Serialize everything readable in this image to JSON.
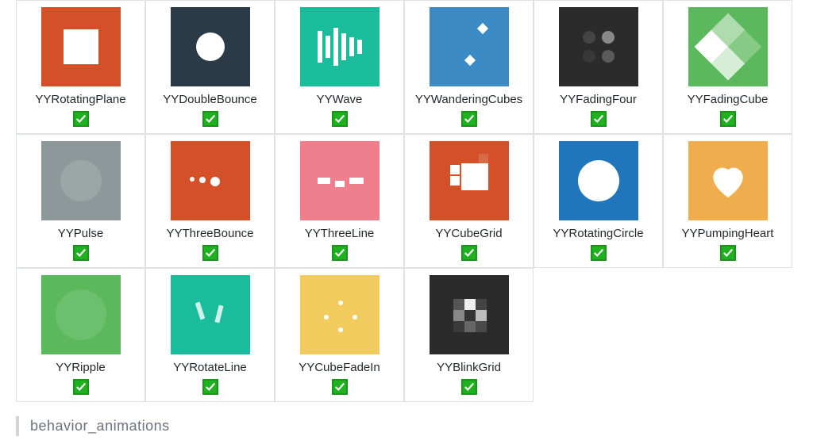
{
  "colors": {
    "orange": "#d35028",
    "darknavy": "#2a3a47",
    "teal": "#1abc9c",
    "blue": "#3b8ac4",
    "charcoal": "#2b2b2b",
    "green": "#5cb85c",
    "grey": "#8c9899",
    "pink": "#ef7f8d",
    "bluestrong": "#2075bb",
    "amber": "#f0ad4e",
    "mustard": "#f2cb5f",
    "check_green": "#1fb11f"
  },
  "animations": {
    "rows": [
      [
        {
          "id": "rotating-plane",
          "label": "YYRotatingPlane",
          "bg": "orange",
          "checked": true
        },
        {
          "id": "double-bounce",
          "label": "YYDoubleBounce",
          "bg": "darknavy",
          "checked": true
        },
        {
          "id": "wave",
          "label": "YYWave",
          "bg": "teal",
          "checked": true
        },
        {
          "id": "wandering-cubes",
          "label": "YYWanderingCubes",
          "bg": "blue",
          "checked": true
        },
        {
          "id": "fading-four",
          "label": "YYFadingFour",
          "bg": "charcoal",
          "checked": true
        },
        {
          "id": "fading-cube",
          "label": "YYFadingCube",
          "bg": "green",
          "checked": true
        }
      ],
      [
        {
          "id": "pulse",
          "label": "YYPulse",
          "bg": "grey",
          "checked": true
        },
        {
          "id": "three-bounce",
          "label": "YYThreeBounce",
          "bg": "orange",
          "checked": true
        },
        {
          "id": "three-line",
          "label": "YYThreeLine",
          "bg": "pink",
          "checked": true
        },
        {
          "id": "cube-grid",
          "label": "YYCubeGrid",
          "bg": "orange",
          "checked": true
        },
        {
          "id": "rotating-circle",
          "label": "YYRotatingCircle",
          "bg": "bluestrong",
          "checked": true
        },
        {
          "id": "pumping-heart",
          "label": "YYPumpingHeart",
          "bg": "amber",
          "checked": true
        }
      ],
      [
        {
          "id": "ripple",
          "label": "YYRipple",
          "bg": "green",
          "checked": true
        },
        {
          "id": "rotate-line",
          "label": "YYRotateLine",
          "bg": "teal",
          "checked": true
        },
        {
          "id": "cube-fade-in",
          "label": "YYCubeFadeIn",
          "bg": "mustard",
          "checked": true
        },
        {
          "id": "blink-grid",
          "label": "YYBlinkGrid",
          "bg": "charcoal",
          "checked": true
        }
      ]
    ]
  },
  "section_heading": "behavior_animations"
}
